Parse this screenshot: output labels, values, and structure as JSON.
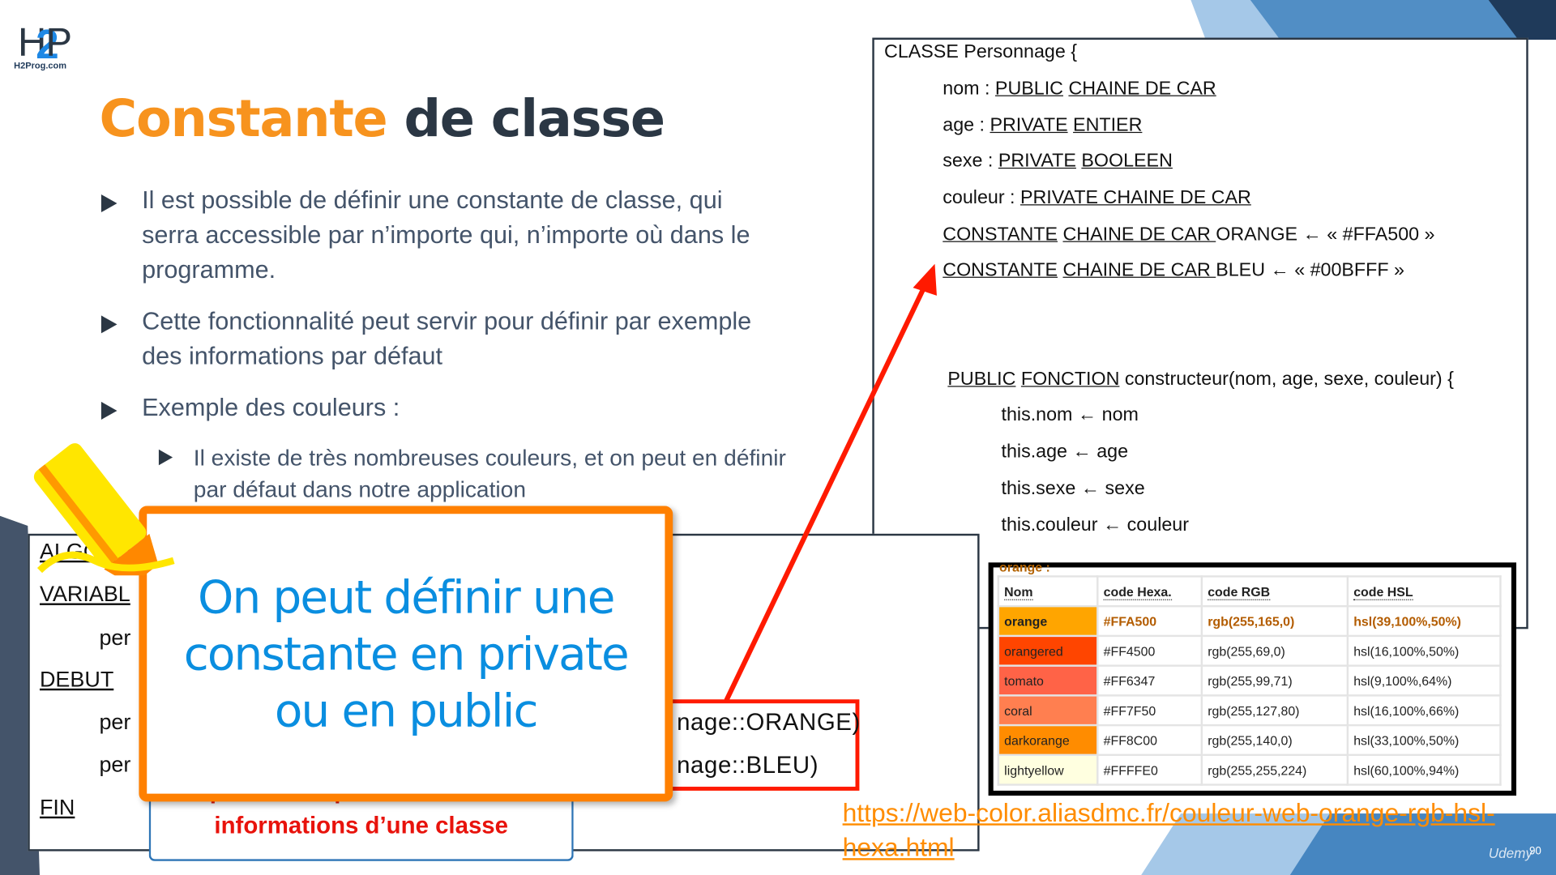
{
  "logo": {
    "text": "H2P",
    "site": "H2Prog.com"
  },
  "title": {
    "highlight": "Constante",
    "rest": "de classe"
  },
  "bullets": [
    {
      "lines": [
        "Il est possible de définir une constante de classe, qui",
        "serra accessible par n’importe qui, n’importe où dans le",
        "programme."
      ]
    },
    {
      "lines": [
        "Cette fonctionnalité peut servir pour définir par exemple",
        "des informations par défaut"
      ]
    },
    {
      "lines": [
        "Exemple des couleurs :"
      ]
    }
  ],
  "sub_bullet": {
    "lines": [
      "Il existe de très nombreuses couleurs, et on peut en définir",
      "par défaut dans notre application"
    ]
  },
  "class_box": {
    "header": "CLASSE Personnage {",
    "attrs": [
      {
        "name": "nom : ",
        "vis": "PUBLIC",
        "type": "CHAINE DE CAR",
        "rest": ""
      },
      {
        "name": "age : ",
        "vis": "PRIVATE",
        "type": "ENTIER",
        "rest": ""
      },
      {
        "name": "sexe : ",
        "vis": "PRIVATE",
        "type": "BOOLEEN",
        "rest": ""
      },
      {
        "name": "couleur : ",
        "vis": "PRIVATE CHAINE DE CAR",
        "type": "",
        "rest": ""
      }
    ],
    "constants": [
      {
        "kw": "CONSTANTE",
        "type": "CHAINE DE CAR ",
        "rest": " ORANGE ← « #FFA500 »"
      },
      {
        "kw": "CONSTANTE",
        "type": "CHAINE DE CAR ",
        "rest": " BLEU ← « #00BFFF »"
      }
    ],
    "ctor": {
      "vis": "PUBLIC",
      "kw": "FONCTION",
      "rest": " constructeur(nom, age, sexe, couleur) {"
    },
    "body": [
      "this.nom ← nom",
      "this.age ← age",
      "this.sexe ← sexe",
      "this.couleur ← couleur"
    ]
  },
  "algo_box": {
    "lines": [
      "ALGORIT",
      "VARIABL",
      "per",
      "DEBUT",
      "per",
      "per",
      "FIN"
    ]
  },
  "red_box": {
    "lines": [
      "nage::ORANGE)",
      "nage::BLEU)"
    ]
  },
  "caption": {
    "lines": [
      "Opérateur :: pour accéder aux",
      "informations d’une classe"
    ]
  },
  "callout": {
    "lines": [
      "On peut définir une",
      "constante en private",
      "ou en public"
    ]
  },
  "color_table": {
    "caption": "orange :",
    "headers": [
      "Nom",
      "code Hexa.",
      "code RGB",
      "code HSL"
    ],
    "rows": [
      {
        "name": "orange",
        "hex": "#FFA500",
        "rgb": "rgb(255,165,0)",
        "hsl": "hsl(39,100%,50%)",
        "bg": "#FFA500",
        "highlight": true
      },
      {
        "name": "orangered",
        "hex": "#FF4500",
        "rgb": "rgb(255,69,0)",
        "hsl": "hsl(16,100%,50%)",
        "bg": "#FF4500"
      },
      {
        "name": "tomato",
        "hex": "#FF6347",
        "rgb": "rgb(255,99,71)",
        "hsl": "hsl(9,100%,64%)",
        "bg": "#FF6347"
      },
      {
        "name": "coral",
        "hex": "#FF7F50",
        "rgb": "rgb(255,127,80)",
        "hsl": "hsl(16,100%,66%)",
        "bg": "#FF7F50"
      },
      {
        "name": "darkorange",
        "hex": "#FF8C00",
        "rgb": "rgb(255,140,0)",
        "hsl": "hsl(33,100%,50%)",
        "bg": "#FF8C00"
      },
      {
        "name": "lightyellow",
        "hex": "#FFFFE0",
        "rgb": "rgb(255,255,224)",
        "hsl": "hsl(60,100%,94%)",
        "bg": "#FFFFE0"
      }
    ]
  },
  "link": {
    "lines": [
      "https://web-color.aliasdmc.fr/couleur-web-orange-rgb-hsl-",
      "hexa.html"
    ]
  },
  "watermark": "Udemy",
  "page_number": "90",
  "colors": {
    "accent_orange": "#f7931e",
    "dark": "#2b3744",
    "callout_blue": "#0a8ee0",
    "red": "#ff1a00"
  }
}
